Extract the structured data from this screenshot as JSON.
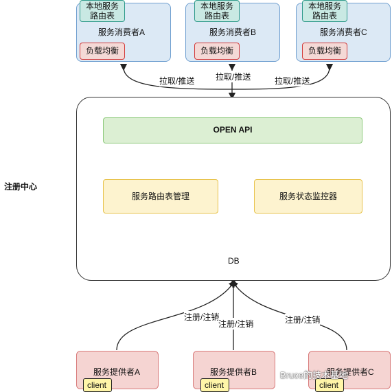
{
  "registry_label": "注册中心",
  "consumers": [
    {
      "route_table": "本地服务\n路由表",
      "name": "服务消费者A",
      "lb": "负载均衡"
    },
    {
      "route_table": "本地服务\n路由表",
      "name": "服务消费者B",
      "lb": "负载均衡"
    },
    {
      "route_table": "本地服务\n路由表",
      "name": "服务消费者C",
      "lb": "负载均衡"
    }
  ],
  "pull_push": [
    "拉取/推送",
    "拉取/推送",
    "拉取/推送"
  ],
  "open_api": "OPEN API",
  "route_mgmt": "服务路由表管理",
  "status_monitor": "服务状态监控器",
  "db": "DB",
  "register": [
    "注册/注销",
    "注册/注销",
    "注册/注销"
  ],
  "providers": [
    {
      "name": "服务提供者A",
      "client": "client"
    },
    {
      "name": "服务提供者B",
      "client": "client"
    },
    {
      "name": "服务提供者C",
      "client": "client"
    }
  ],
  "watermark": "Bruce的技术基地"
}
